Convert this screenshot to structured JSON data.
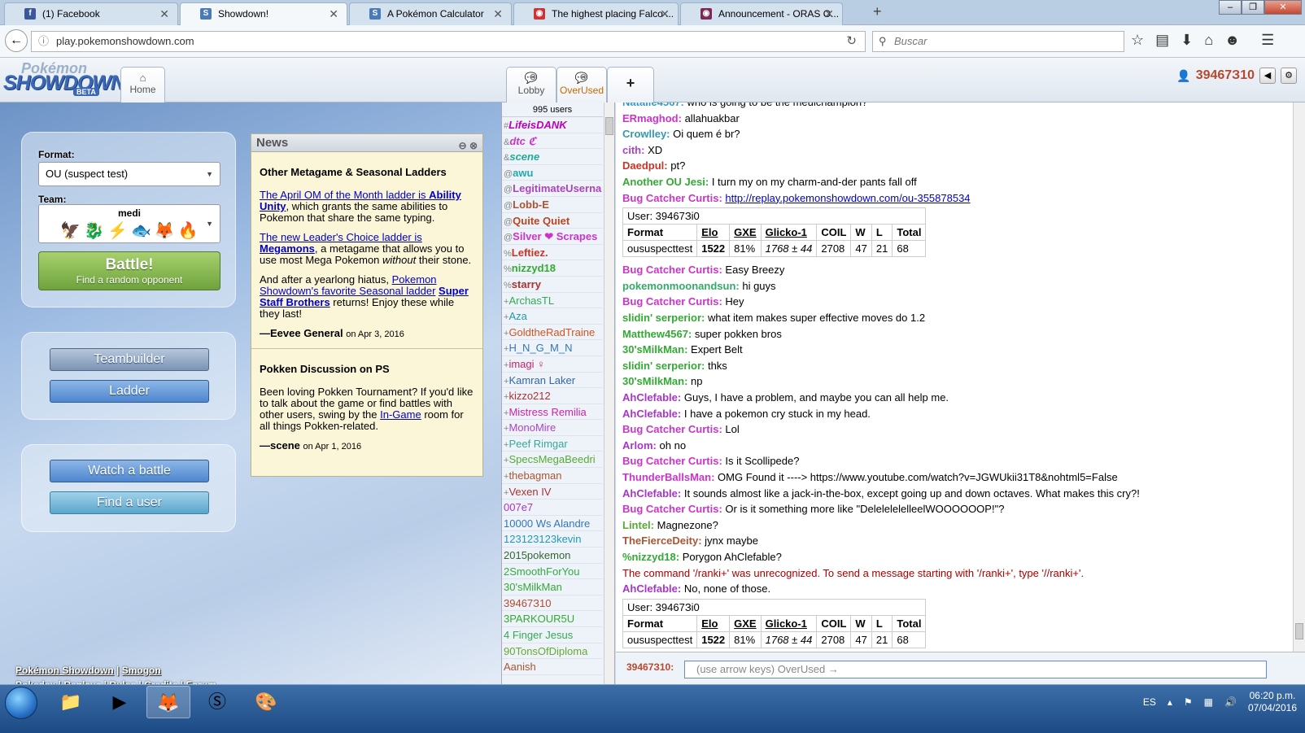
{
  "browser": {
    "tabs": [
      {
        "label": "(1) Facebook",
        "icon": "f",
        "color": "#3b5998"
      },
      {
        "label": "Showdown!",
        "icon": "S",
        "color": "#4a7ab8"
      },
      {
        "label": "A Pokémon Calculator",
        "icon": "S",
        "color": "#4a7ab8"
      },
      {
        "label": "The highest placing Falco ...",
        "icon": "◉",
        "color": "#c33"
      },
      {
        "label": "Announcement - ORAS O...",
        "icon": "◉",
        "color": "#7a2a55"
      }
    ],
    "new_tab": "+",
    "url": "play.pokemonshowdown.com",
    "search_placeholder": "Buscar"
  },
  "header": {
    "logo_top": "Pokémon",
    "logo_main": "SHOWDOWN",
    "logo_badge": "BETA",
    "home_label": "Home",
    "rooms": [
      {
        "label": "Lobby"
      },
      {
        "label": "OverUsed"
      }
    ],
    "add_room": "+",
    "username": "39467З10"
  },
  "menu": {
    "format_label": "Format:",
    "format_value": "OU (suspect test)",
    "team_label": "Team:",
    "team_name": "medi",
    "battle_label": "Battle!",
    "battle_sub": "Find a random opponent",
    "teambuilder": "Teambuilder",
    "ladder": "Ladder",
    "watch": "Watch a battle",
    "find_user": "Find a user"
  },
  "footer": {
    "l1": "Pokémon Showdown",
    "sep": "|",
    "l2": "Smogon",
    "l3": "Pokedex",
    "l4": "Replays",
    "l5": "Rules",
    "l6": "Credits",
    "l7": "Forum"
  },
  "news": {
    "title": "News",
    "items": [
      {
        "title": "Other Metagame & Seasonal Ladders",
        "p1_link": "The April OM of the Month ladder is ",
        "p1_bold": "Ability Unity",
        "p1_rest": ", which grants the same abilities to Pokemon that share the same typing.",
        "p2_link": "The new Leader's Choice ladder is ",
        "p2_bold": "Megamons",
        "p2_rest1": ", a metagame that allows you to use most Mega Pokemon ",
        "p2_em": "without",
        "p2_rest2": " their stone.",
        "p3_a": "And after a yearlong hiatus, ",
        "p3_link": "Pokemon Showdown's favorite Seasonal ladder",
        "p3_sp": " ",
        "p3_bold": "Super Staff Brothers",
        "p3_rest": " returns! Enjoy these while they last!",
        "author": "—Eevee General",
        "date": "on Apr 3, 2016"
      },
      {
        "title": "Pokken Discussion on PS",
        "body_a": "Been loving Pokken Tournament? If you'd like to talk about the game or find battles with other users, swing by the ",
        "body_link": "In-Game",
        "body_b": " room for all things Pokken-related.",
        "author": "—scene",
        "date": "on Apr 1, 2016"
      }
    ]
  },
  "userlist": {
    "count": "995 users",
    "users": [
      {
        "g": "#",
        "n": "LifeisDANK",
        "c": "#b0b",
        "s": "bi"
      },
      {
        "g": "&",
        "n": "dtc ℭ",
        "c": "#c3c",
        "s": "bi"
      },
      {
        "g": "&",
        "n": "scene",
        "c": "#2a9",
        "s": "bi"
      },
      {
        "g": "@",
        "n": "awu",
        "c": "#2aa",
        "s": "b"
      },
      {
        "g": "@",
        "n": "LegitimateUserna",
        "c": "#a4b",
        "s": "b"
      },
      {
        "g": "@",
        "n": "Lobb-E",
        "c": "#a53",
        "s": "b"
      },
      {
        "g": "@",
        "n": "Quite Quiet",
        "c": "#b42",
        "s": "b"
      },
      {
        "g": "@",
        "n": "Silver ❤ Scrapes",
        "c": "#c3c",
        "s": "b"
      },
      {
        "g": "%",
        "n": "Leftiez.",
        "c": "#c32",
        "s": "b"
      },
      {
        "g": "%",
        "n": "nizzyd18",
        "c": "#3a3",
        "s": "b"
      },
      {
        "g": "%",
        "n": "starry",
        "c": "#a33",
        "s": "b"
      },
      {
        "g": "+",
        "n": "ArchasTL",
        "c": "#3a5",
        "s": ""
      },
      {
        "g": "+",
        "n": "Aza",
        "c": "#29a",
        "s": ""
      },
      {
        "g": "+",
        "n": "GoldtheRadTraine",
        "c": "#c52",
        "s": ""
      },
      {
        "g": "+",
        "n": "H_N_G_M_N",
        "c": "#37b",
        "s": ""
      },
      {
        "g": "+",
        "n": "imagi ♀",
        "c": "#c26",
        "s": ""
      },
      {
        "g": "+",
        "n": "Kamran Laker",
        "c": "#36a",
        "s": ""
      },
      {
        "g": "+",
        "n": "kizzo212",
        "c": "#a33",
        "s": ""
      },
      {
        "g": "+",
        "n": "Mistress Remilia",
        "c": "#c2a",
        "s": ""
      },
      {
        "g": "+",
        "n": "MonoMire",
        "c": "#a4c",
        "s": ""
      },
      {
        "g": "+",
        "n": "Peef Rimgar",
        "c": "#3a9",
        "s": ""
      },
      {
        "g": "+",
        "n": "SpecsMegaBeedri",
        "c": "#5a3",
        "s": ""
      },
      {
        "g": "+",
        "n": "thebagman",
        "c": "#a53",
        "s": ""
      },
      {
        "g": "+",
        "n": "Vexen IV",
        "c": "#a33",
        "s": ""
      },
      {
        "g": "",
        "n": "007e7",
        "c": "#a3c",
        "s": ""
      },
      {
        "g": "",
        "n": "10000 Ws Alandre",
        "c": "#37b",
        "s": ""
      },
      {
        "g": "",
        "n": "123123123kevin",
        "c": "#29b",
        "s": ""
      },
      {
        "g": "",
        "n": "2015pokemon",
        "c": "#363",
        "s": ""
      },
      {
        "g": "",
        "n": "2SmoothForYou",
        "c": "#3a4",
        "s": ""
      },
      {
        "g": "",
        "n": "30'sMilkMan",
        "c": "#3a3",
        "s": ""
      },
      {
        "g": "",
        "n": "39467З10",
        "c": "#b5482f",
        "s": ""
      },
      {
        "g": "",
        "n": "3PARKOUR5U",
        "c": "#3a3",
        "s": ""
      },
      {
        "g": "",
        "n": "4 Finger Jesus",
        "c": "#3a5",
        "s": ""
      },
      {
        "g": "",
        "n": "90TonsOfDiploma",
        "c": "#6a3",
        "s": ""
      },
      {
        "g": "",
        "n": "Aanish",
        "c": "#a53",
        "s": ""
      }
    ]
  },
  "chat": {
    "messages": [
      {
        "u": "Natalie4567:",
        "c": "#39c",
        "t": "who is going to be the meulchampion?"
      },
      {
        "u": "ERmaghod:",
        "c": "#c3c",
        "t": "allahuakbar"
      },
      {
        "u": "Crowlley:",
        "c": "#39a",
        "t": "Oi quem é br?"
      },
      {
        "u": "cith:",
        "c": "#a4c",
        "t": "XD"
      },
      {
        "u": "Daedpul:",
        "c": "#c32",
        "t": "pt?"
      },
      {
        "u": "Another OU Jesi:",
        "c": "#3a3",
        "t": "I turn my on my charm-and-der pants fall off"
      },
      {
        "u": "Bug Catcher Curtis:",
        "c": "#c3c",
        "link": "http://replay.pokemonshowdown.com/ou-355878534"
      },
      {
        "table": true,
        "user": "User: 39467Зi0",
        "rows": [
          "oususpecttest",
          "1522",
          "81%",
          "1768 ± 44",
          "2708",
          "47",
          "21",
          "68"
        ]
      },
      {
        "u": "Bug Catcher Curtis:",
        "c": "#c3c",
        "t": "Easy Breezy"
      },
      {
        "u": "pokemonmoonandsun:",
        "c": "#3a6",
        "t": "hi guys"
      },
      {
        "u": "Bug Catcher Curtis:",
        "c": "#c3c",
        "t": "Hey"
      },
      {
        "u": "slidin' serperior:",
        "c": "#3a3",
        "t": "what item makes super effective moves do 1.2"
      },
      {
        "u": "Matthew4567:",
        "c": "#3a3",
        "t": "super pokken bros"
      },
      {
        "u": "30'sMilkMan:",
        "c": "#3a3",
        "t": "Expert Belt"
      },
      {
        "u": "slidin' serperior:",
        "c": "#3a3",
        "t": "thks"
      },
      {
        "u": "30'sMilkMan:",
        "c": "#3a3",
        "t": "np"
      },
      {
        "u": "AhClefable:",
        "c": "#a3c",
        "t": "Guys, I have a problem, and maybe you can all help me."
      },
      {
        "u": "AhClefable:",
        "c": "#a3c",
        "t": "I have a pokemon cry stuck in my head."
      },
      {
        "u": "Bug Catcher Curtis:",
        "c": "#c3c",
        "t": "Lol"
      },
      {
        "u": "Arlom:",
        "c": "#a3c",
        "t": "oh no"
      },
      {
        "u": "Bug Catcher Curtis:",
        "c": "#c3c",
        "t": "Is it Scollipede?"
      },
      {
        "u": "ThunderBallsMan:",
        "c": "#c3c",
        "t": "OMG Found it ----> https://www.youtube.com/watch?v=JGWUkii31T8&nohtml5=False"
      },
      {
        "u": "AhClefable:",
        "c": "#a3c",
        "t": "It sounds almost like a jack-in-the-box, except going up and down octaves. What makes this cry?!"
      },
      {
        "u": "Bug Catcher Curtis:",
        "c": "#c3c",
        "t": "Or is it something more like \"DelelelelelleelWOOOOOOP!\"?"
      },
      {
        "u": "Lintel:",
        "c": "#5a3",
        "t": "Magnezone?"
      },
      {
        "u": "TheFierceDeity:",
        "c": "#a53",
        "t": "jynx maybe"
      },
      {
        "u": "%nizzyd18:",
        "c": "#3a3",
        "t": "Porygon AhClefable?"
      },
      {
        "err": "The command '/ranki+' was unrecognized. To send a message starting with '/ranki+', type '//ranki+'."
      },
      {
        "u": "AhClefable:",
        "c": "#a3c",
        "t": "No, none of those."
      },
      {
        "table": true,
        "user": "User: 39467Зi0",
        "rows": [
          "oususpecttest",
          "1522",
          "81%",
          "1768 ± 44",
          "2708",
          "47",
          "21",
          "68"
        ]
      }
    ],
    "table_headers": [
      "Format",
      "Elo",
      "GXE",
      "Glicko-1",
      "COIL",
      "W",
      "L",
      "Total"
    ],
    "input_user": "39467З10:",
    "input_placeholder": "(use arrow keys) OverUsed →"
  },
  "taskbar": {
    "lang": "ES",
    "time": "06:20 p.m.",
    "date": "07/04/2016"
  }
}
